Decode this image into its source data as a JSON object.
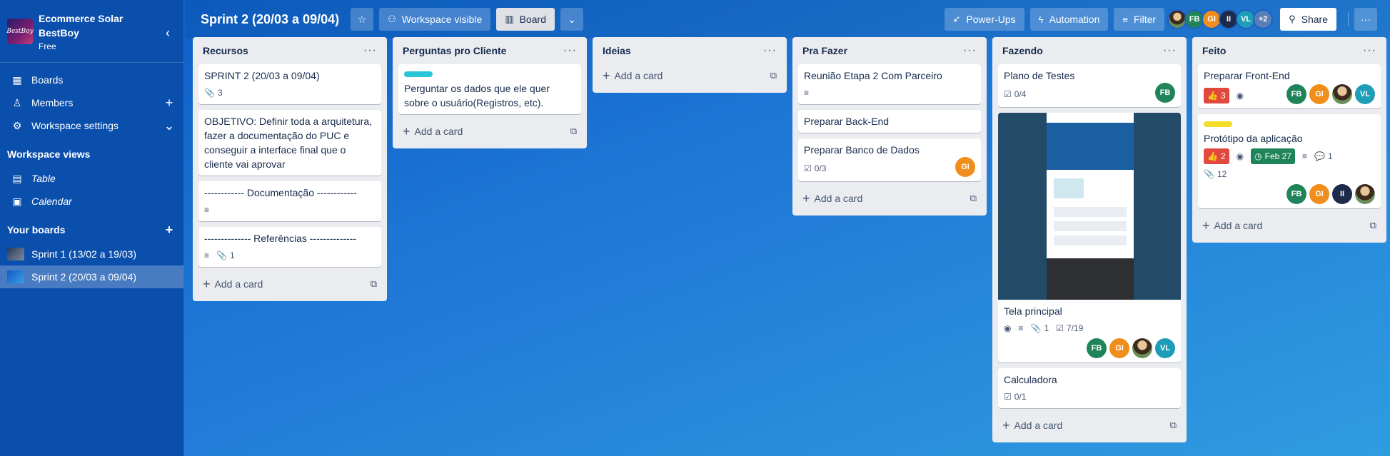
{
  "workspace": {
    "name": "Ecommerce Solar BestBoy",
    "plan": "Free",
    "logo_text": "BestBoy"
  },
  "sidebar": {
    "nav": [
      {
        "label": "Boards",
        "icon": "board-icon"
      },
      {
        "label": "Members",
        "icon": "person-icon"
      },
      {
        "label": "Workspace settings",
        "icon": "gear-icon"
      }
    ],
    "views_title": "Workspace views",
    "views": [
      {
        "label": "Table",
        "icon": "table-icon"
      },
      {
        "label": "Calendar",
        "icon": "calendar-icon"
      }
    ],
    "boards_title": "Your boards",
    "boards": [
      {
        "label": "Sprint 1 (13/02 a 19/03)",
        "color": "#4a5d7a"
      },
      {
        "label": "Sprint 2 (20/03 a 09/04)",
        "color": "#2a7fd6"
      }
    ]
  },
  "topbar": {
    "title": "Sprint 2 (20/03 a 09/04)",
    "visibility": "Workspace visible",
    "view": "Board",
    "powerups": "Power-Ups",
    "automation": "Automation",
    "filter": "Filter",
    "members": [
      "FB",
      "GI",
      "II",
      "VL"
    ],
    "more_members": "+2",
    "share": "Share"
  },
  "add_card_label": "Add a card",
  "lists": [
    {
      "title": "Recursos",
      "cards": [
        {
          "title": "SPRINT 2 (20/03 a 09/04)",
          "attachments": "3"
        },
        {
          "title": "OBJETIVO: Definir toda a arquitetura, fazer a documentação do PUC e conseguir a interface final que o cliente vai aprovar"
        },
        {
          "title": "------------ Documentação ------------"
        },
        {
          "title": "-------------- Referências --------------",
          "attachments": "1"
        }
      ]
    },
    {
      "title": "Perguntas pro Cliente",
      "cards": [
        {
          "title": "Perguntar os dados que ele quer sobre o usuário(Registros, etc).",
          "label_color": "#29c4d8"
        }
      ]
    },
    {
      "title": "Ideias",
      "cards": []
    },
    {
      "title": "Pra Fazer",
      "cards": [
        {
          "title": "Reunião Etapa 2 Com Parceiro"
        },
        {
          "title": "Preparar Back-End"
        },
        {
          "title": "Preparar Banco de Dados",
          "checklist": "0/3",
          "members": [
            "GI"
          ]
        }
      ]
    },
    {
      "title": "Fazendo",
      "cards": [
        {
          "title": "Plano de Testes",
          "checklist": "0/4",
          "members": [
            "FB"
          ]
        },
        {
          "title": "Tela principal",
          "attachments": "1",
          "checklist": "7/19",
          "members": [
            "FB",
            "GI",
            "photo",
            "VL"
          ]
        },
        {
          "title": "Calculadora",
          "checklist": "0/1"
        }
      ]
    },
    {
      "title": "Feito",
      "cards": [
        {
          "title": "Preparar Front-End",
          "votes": "3",
          "members": [
            "FB",
            "GI",
            "photo",
            "VL"
          ]
        },
        {
          "title": "Protótipo da aplicação",
          "votes": "2",
          "due": "Feb 27",
          "comments": "1",
          "attachments": "12",
          "label_color": "#f5dd29",
          "members": [
            "FB",
            "GI",
            "II",
            "photo"
          ]
        }
      ]
    }
  ],
  "colors": {
    "sidebar": "#0b4fad",
    "board_bg": "#1f78d6",
    "list_bg": "#ebecf0",
    "vote_red": "#e2483d",
    "due_green": "#1f845a"
  }
}
